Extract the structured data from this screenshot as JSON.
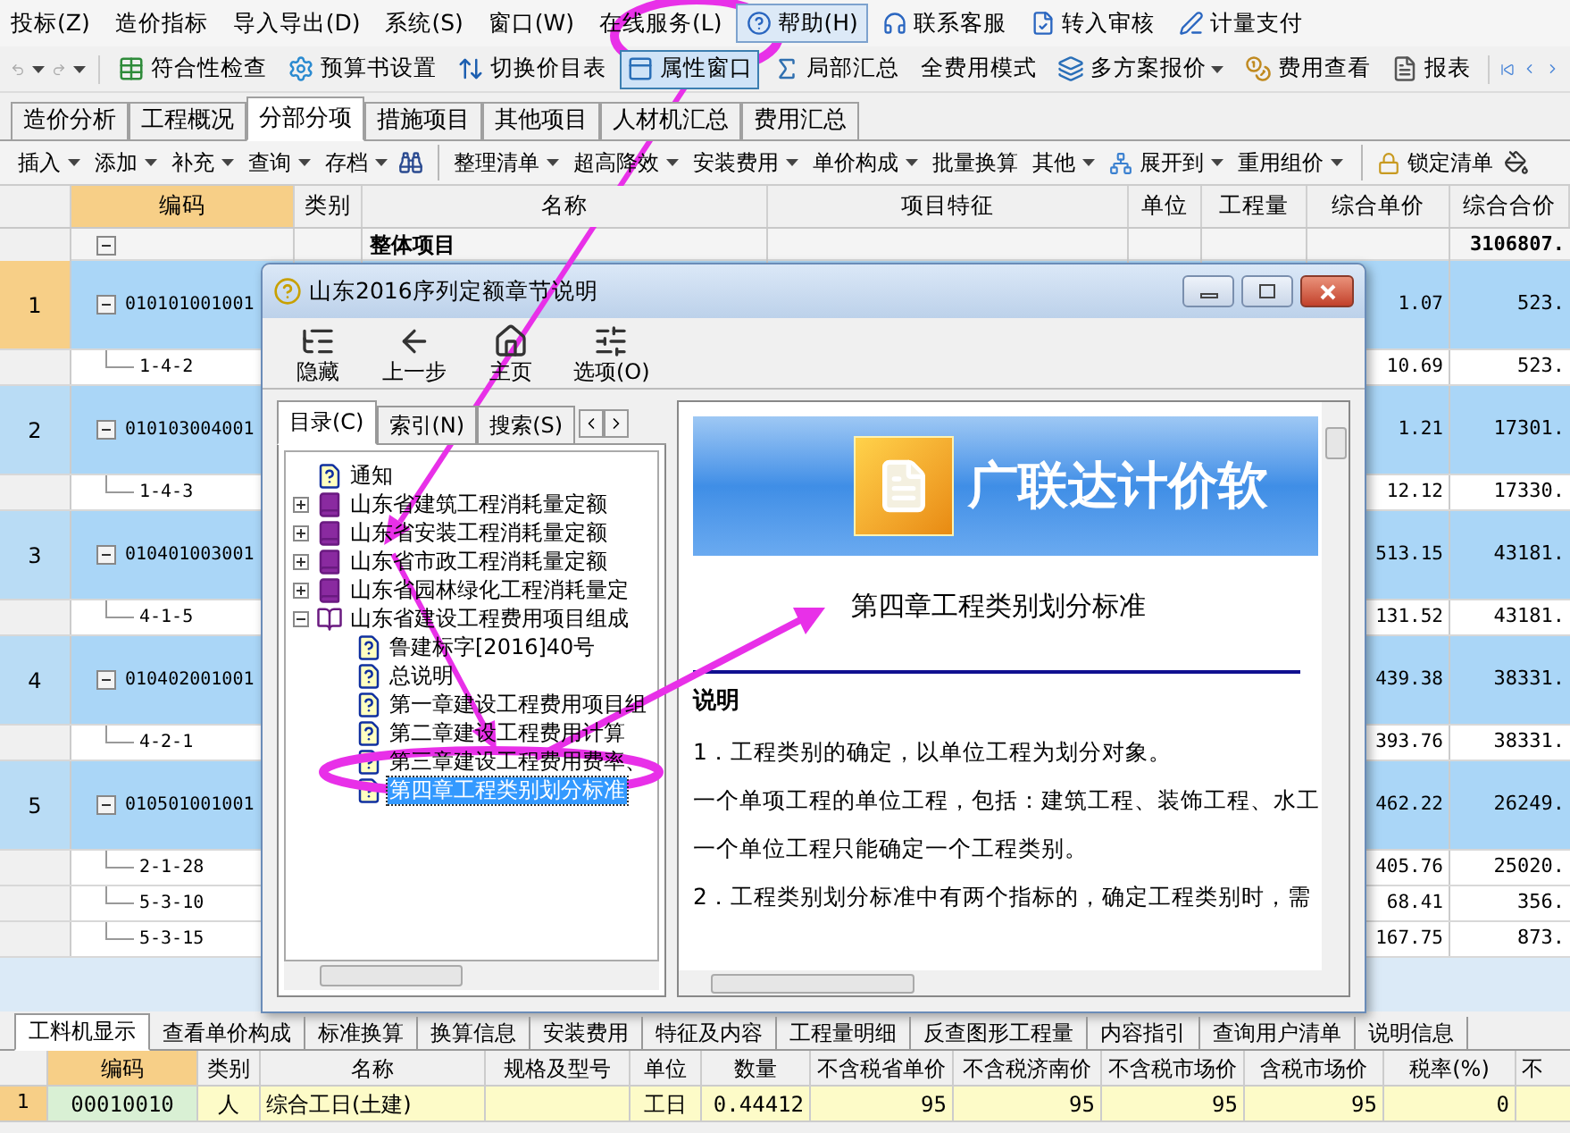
{
  "menu": [
    {
      "label": "投标(Z)",
      "selected": false
    },
    {
      "label": "造价指标",
      "selected": false
    },
    {
      "label": "导入导出(D)",
      "selected": false
    },
    {
      "label": "系统(S)",
      "selected": false
    },
    {
      "label": "窗口(W)",
      "selected": false
    },
    {
      "label": "在线服务(L)",
      "selected": false
    },
    {
      "label": "帮助(H)",
      "selected": true
    },
    {
      "label": "联系客服",
      "selected": false
    },
    {
      "label": "转入审核",
      "selected": false
    },
    {
      "label": "计量支付",
      "selected": false
    }
  ],
  "toolbar": [
    {
      "label": "符合性检查",
      "pressed": false,
      "dropdown": false
    },
    {
      "label": "预算书设置",
      "pressed": false,
      "dropdown": false
    },
    {
      "label": "切换价目表",
      "pressed": false,
      "dropdown": false
    },
    {
      "label": "属性窗口",
      "pressed": true,
      "dropdown": false
    },
    {
      "label": "局部汇总",
      "pressed": false,
      "dropdown": false
    },
    {
      "label": "全费用模式",
      "pressed": false,
      "dropdown": false
    },
    {
      "label": "多方案报价",
      "pressed": false,
      "dropdown": true
    },
    {
      "label": "费用查看",
      "pressed": false,
      "dropdown": false
    },
    {
      "label": "报表",
      "pressed": false,
      "dropdown": false
    }
  ],
  "tabs": [
    {
      "label": "造价分析",
      "selected": false
    },
    {
      "label": "工程概况",
      "selected": false
    },
    {
      "label": "分部分项",
      "selected": true
    },
    {
      "label": "措施项目",
      "selected": false
    },
    {
      "label": "其他项目",
      "selected": false
    },
    {
      "label": "人材机汇总",
      "selected": false
    },
    {
      "label": "费用汇总",
      "selected": false
    }
  ],
  "edit_toolbar": [
    {
      "label": "插入",
      "dropdown": true,
      "separator_before": false
    },
    {
      "label": "添加",
      "dropdown": true,
      "separator_before": false
    },
    {
      "label": "补充",
      "dropdown": true,
      "separator_before": false
    },
    {
      "label": "查询",
      "dropdown": true,
      "separator_before": false
    },
    {
      "label": "存档",
      "dropdown": true,
      "separator_before": false
    },
    {
      "label": "整理清单",
      "dropdown": true,
      "separator_before": true
    },
    {
      "label": "超高降效",
      "dropdown": true,
      "separator_before": false
    },
    {
      "label": "安装费用",
      "dropdown": true,
      "separator_before": false
    },
    {
      "label": "单价构成",
      "dropdown": true,
      "separator_before": false
    },
    {
      "label": "批量换算",
      "dropdown": false,
      "separator_before": false
    },
    {
      "label": "其他",
      "dropdown": true,
      "separator_before": false
    },
    {
      "label": "展开到",
      "dropdown": true,
      "separator_before": false
    },
    {
      "label": "重用组价",
      "dropdown": true,
      "separator_before": false
    },
    {
      "label": "锁定清单",
      "dropdown": false,
      "separator_before": true
    }
  ],
  "table": {
    "columns": [
      {
        "label": "编码",
        "selected": true
      },
      {
        "label": "类别",
        "selected": false
      },
      {
        "label": "名称",
        "selected": false
      },
      {
        "label": "项目特征",
        "selected": false
      },
      {
        "label": "单位",
        "selected": false
      },
      {
        "label": "工程量",
        "selected": false
      },
      {
        "label": "综合单价",
        "selected": false
      },
      {
        "label": "综合合价",
        "selected": false
      }
    ],
    "rows": [
      {
        "kind": "group",
        "name": "整体项目",
        "total": "3106807.",
        "expanded": true,
        "selected": false
      },
      {
        "kind": "item",
        "num": "1",
        "code": "010101001001",
        "unit_price": "1.07",
        "total": "523.",
        "expanded": true,
        "selected": true
      },
      {
        "kind": "sub",
        "code": "1-4-2",
        "unit_price": "10.69",
        "total": "523.",
        "selected": false
      },
      {
        "kind": "item",
        "num": "2",
        "code": "010103004001",
        "unit_price": "1.21",
        "total": "17301.",
        "expanded": true,
        "selected": false
      },
      {
        "kind": "sub",
        "code": "1-4-3",
        "unit_price": "12.12",
        "total": "17330.",
        "selected": false
      },
      {
        "kind": "item",
        "num": "3",
        "code": "010401003001",
        "unit_price": "513.15",
        "total": "43181.",
        "expanded": true,
        "selected": false
      },
      {
        "kind": "sub",
        "code": "4-1-5",
        "unit_price": "131.52",
        "total": "43181.",
        "selected": false
      },
      {
        "kind": "item",
        "num": "4",
        "code": "010402001001",
        "unit_price": "439.38",
        "total": "38331.",
        "expanded": true,
        "selected": false
      },
      {
        "kind": "sub",
        "code": "4-2-1",
        "unit_price": "393.76",
        "total": "38331.",
        "selected": false
      },
      {
        "kind": "item",
        "num": "5",
        "code": "010501001001",
        "unit_price": "462.22",
        "total": "26249.",
        "expanded": true,
        "selected": false
      },
      {
        "kind": "sub",
        "code": "2-1-28",
        "unit_price": "405.76",
        "total": "25020.",
        "selected": false
      },
      {
        "kind": "sub",
        "code": "5-3-10",
        "unit_price": "68.41",
        "total": "356.",
        "selected": false
      },
      {
        "kind": "sub",
        "code": "5-3-15",
        "unit_price": "167.75",
        "total": "873.",
        "selected": false
      }
    ]
  },
  "dialog": {
    "title": "山东2016序列定额章节说明",
    "buttons": [
      {
        "label": "隐藏"
      },
      {
        "label": "上一步"
      },
      {
        "label": "主页"
      },
      {
        "label": "选项(O)"
      }
    ],
    "tabs": [
      {
        "label": "目录(C)",
        "selected": true
      },
      {
        "label": "索引(N)",
        "selected": false
      },
      {
        "label": "搜索(S)",
        "selected": false
      }
    ],
    "tree": [
      {
        "kind": "doc",
        "label": "通知",
        "selected": false
      },
      {
        "kind": "book",
        "label": "山东省建筑工程消耗量定额",
        "expanded": false,
        "selected": false
      },
      {
        "kind": "book",
        "label": "山东省安装工程消耗量定额",
        "expanded": false,
        "selected": false
      },
      {
        "kind": "book",
        "label": "山东省市政工程消耗量定额",
        "expanded": false,
        "selected": false
      },
      {
        "kind": "book",
        "label": "山东省园林绿化工程消耗量定",
        "expanded": false,
        "selected": false
      },
      {
        "kind": "book",
        "label": "山东省建设工程费用项目组成",
        "expanded": true,
        "selected": false,
        "children": [
          {
            "kind": "doc",
            "label": "鲁建标字[2016]40号",
            "selected": false
          },
          {
            "kind": "doc",
            "label": "总说明",
            "selected": false
          },
          {
            "kind": "doc",
            "label": "第一章建设工程费用项目组",
            "selected": false
          },
          {
            "kind": "doc",
            "label": "第二章建设工程费用计算",
            "selected": false
          },
          {
            "kind": "doc",
            "label": "第三章建设工程费用费率、",
            "selected": false
          },
          {
            "kind": "doc",
            "label": "第四章工程类别划分标准",
            "selected": true
          }
        ]
      }
    ],
    "banner": "广联达计价软",
    "heading": "第四章工程类别划分标准",
    "section": "说明",
    "paragraphs": [
      "1．工程类别的确定，以单位工程为划分对象。",
      "一个单项工程的单位工程，包括：建筑工程、装饰工程、水工",
      "一个单位工程只能确定一个工程类别。",
      "2．工程类别划分标准中有两个指标的，确定工程类别时，需"
    ]
  },
  "bottom": {
    "tabs": [
      {
        "label": "工料机显示",
        "selected": true
      },
      {
        "label": "查看单价构成",
        "selected": false
      },
      {
        "label": "标准换算",
        "selected": false
      },
      {
        "label": "换算信息",
        "selected": false
      },
      {
        "label": "安装费用",
        "selected": false
      },
      {
        "label": "特征及内容",
        "selected": false
      },
      {
        "label": "工程量明细",
        "selected": false
      },
      {
        "label": "反查图形工程量",
        "selected": false
      },
      {
        "label": "内容指引",
        "selected": false
      },
      {
        "label": "查询用户清单",
        "selected": false
      },
      {
        "label": "说明信息",
        "selected": false
      }
    ],
    "columns": [
      {
        "label": "编码",
        "selected": true
      },
      {
        "label": "类别",
        "selected": false
      },
      {
        "label": "名称",
        "selected": false
      },
      {
        "label": "规格及型号",
        "selected": false
      },
      {
        "label": "单位",
        "selected": false
      },
      {
        "label": "数量",
        "selected": false
      },
      {
        "label": "不含税省单价",
        "selected": false
      },
      {
        "label": "不含税济南价",
        "selected": false
      },
      {
        "label": "不含税市场价",
        "selected": false
      },
      {
        "label": "含税市场价",
        "selected": false
      },
      {
        "label": "税率(%)",
        "selected": false
      },
      {
        "label": "不",
        "selected": false
      }
    ],
    "rows": [
      {
        "num": "1",
        "cells": [
          "00010010",
          "人",
          "综合工日(土建)",
          null,
          "工日",
          "0.44412",
          "95",
          "95",
          "95",
          "95",
          "0",
          null
        ]
      }
    ]
  }
}
